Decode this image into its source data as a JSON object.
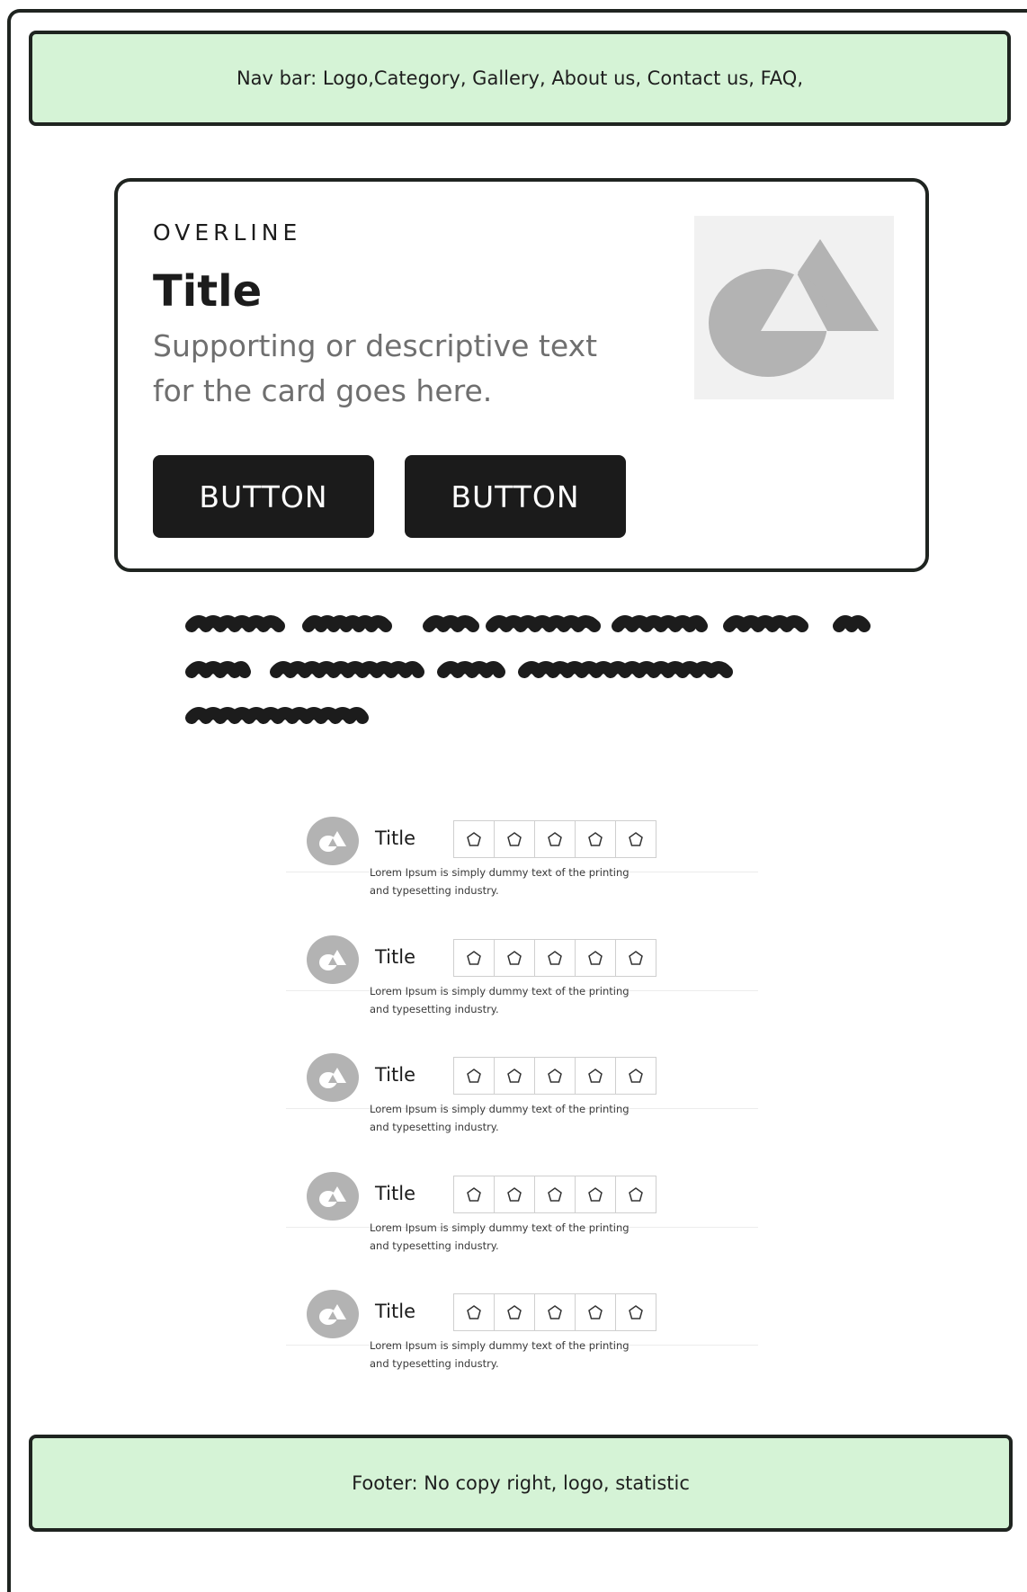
{
  "nav": {
    "label": "Nav bar: Logo,Category, Gallery, About us, Contact us, FAQ,"
  },
  "card": {
    "overline": "OVERLINE",
    "title": "Title",
    "description": "Supporting or descriptive text for the card goes here.",
    "buttons": [
      {
        "label": "BUTTON"
      },
      {
        "label": "BUTTON"
      }
    ],
    "media_icon": "shapes-placeholder-icon"
  },
  "list": {
    "items": [
      {
        "title": "Title",
        "description": "Lorem Ipsum is simply dummy text of the printing and typesetting industry.",
        "avatar_icon": "shapes-icon",
        "rating_icons": [
          "pentagon-icon",
          "pentagon-icon",
          "pentagon-icon",
          "pentagon-icon",
          "pentagon-icon"
        ]
      },
      {
        "title": "Title",
        "description": "Lorem Ipsum is simply dummy text of the printing and typesetting industry.",
        "avatar_icon": "shapes-icon",
        "rating_icons": [
          "pentagon-icon",
          "pentagon-icon",
          "pentagon-icon",
          "pentagon-icon",
          "pentagon-icon"
        ]
      },
      {
        "title": "Title",
        "description": "Lorem Ipsum is simply dummy text of the printing and typesetting industry.",
        "avatar_icon": "shapes-icon",
        "rating_icons": [
          "pentagon-icon",
          "pentagon-icon",
          "pentagon-icon",
          "pentagon-icon",
          "pentagon-icon"
        ]
      },
      {
        "title": "Title",
        "description": "Lorem Ipsum is simply dummy text of the printing and typesetting industry.",
        "avatar_icon": "shapes-icon",
        "rating_icons": [
          "pentagon-icon",
          "pentagon-icon",
          "pentagon-icon",
          "pentagon-icon",
          "pentagon-icon"
        ]
      },
      {
        "title": "Title",
        "description": "Lorem Ipsum is simply dummy text of the printing and typesetting industry.",
        "avatar_icon": "shapes-icon",
        "rating_icons": [
          "pentagon-icon",
          "pentagon-icon",
          "pentagon-icon",
          "pentagon-icon",
          "pentagon-icon"
        ]
      }
    ]
  },
  "footer": {
    "label": "Footer: No copy right, logo, statistic"
  },
  "colors": {
    "accent_green": "#d5f3d6",
    "border": "#1f2420",
    "button": "#1b1b1b",
    "placeholder_gray": "#b3b3b3"
  }
}
